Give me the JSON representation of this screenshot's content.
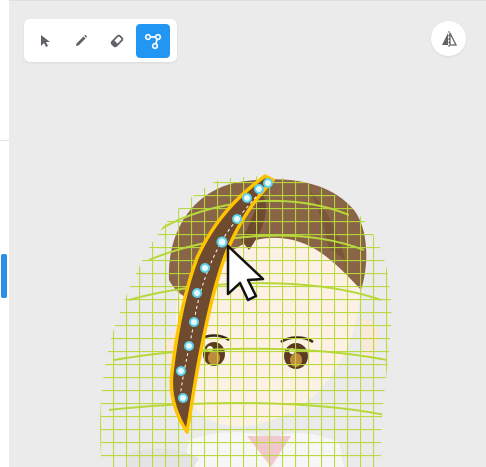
{
  "colors": {
    "canvas_bg": "#ebebeb",
    "accent_blue": "#2196f3",
    "mesh_green": "#b5d63c",
    "selection_yellow": "#ffc400",
    "hair_brown": "#6e4a2e",
    "skin": "#fdf1e6"
  },
  "toolbar": {
    "tools": [
      {
        "name": "select",
        "icon": "cursor-arrow-icon",
        "active": false
      },
      {
        "name": "pen",
        "icon": "pencil-icon",
        "active": false
      },
      {
        "name": "eraser",
        "icon": "eraser-icon",
        "active": false
      },
      {
        "name": "path",
        "icon": "bezier-path-icon",
        "active": true
      }
    ]
  },
  "flip_button": {
    "icon": "flip-horizontal-icon"
  }
}
